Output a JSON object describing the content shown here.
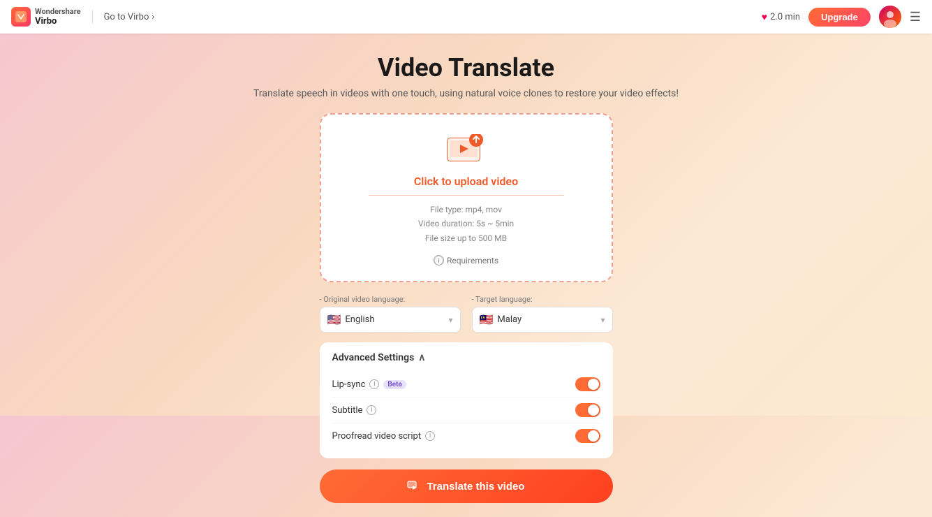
{
  "header": {
    "logo_brand": "Wondershare",
    "logo_product": "Virbo",
    "go_to_virbo_label": "Go to Virbo",
    "time_label": "2.0 min",
    "upgrade_label": "Upgrade",
    "menu_icon": "☰"
  },
  "page": {
    "title": "Video Translate",
    "subtitle": "Translate speech in videos with one touch, using natural voice clones to restore your video effects!"
  },
  "upload": {
    "click_text": "Click to upload video",
    "file_type": "File type: mp4, mov",
    "duration": "Video duration: 5s ~ 5min",
    "size": "File size up to 500 MB",
    "requirements_label": "Requirements"
  },
  "languages": {
    "original_label": "- Original video language:",
    "target_label": "- Target language:",
    "original_value": "English",
    "original_flag": "🇺🇸",
    "target_value": "Malay",
    "target_flag": "🇲🇾"
  },
  "advanced": {
    "header_label": "Advanced Settings",
    "settings": [
      {
        "id": "lip-sync",
        "label": "Lip-sync",
        "has_info": true,
        "has_beta": true,
        "enabled": true
      },
      {
        "id": "subtitle",
        "label": "Subtitle",
        "has_info": true,
        "has_beta": false,
        "enabled": true
      },
      {
        "id": "proofread",
        "label": "Proofread video script",
        "has_info": true,
        "has_beta": false,
        "enabled": true
      }
    ]
  },
  "translate_btn_label": "Translate this video"
}
